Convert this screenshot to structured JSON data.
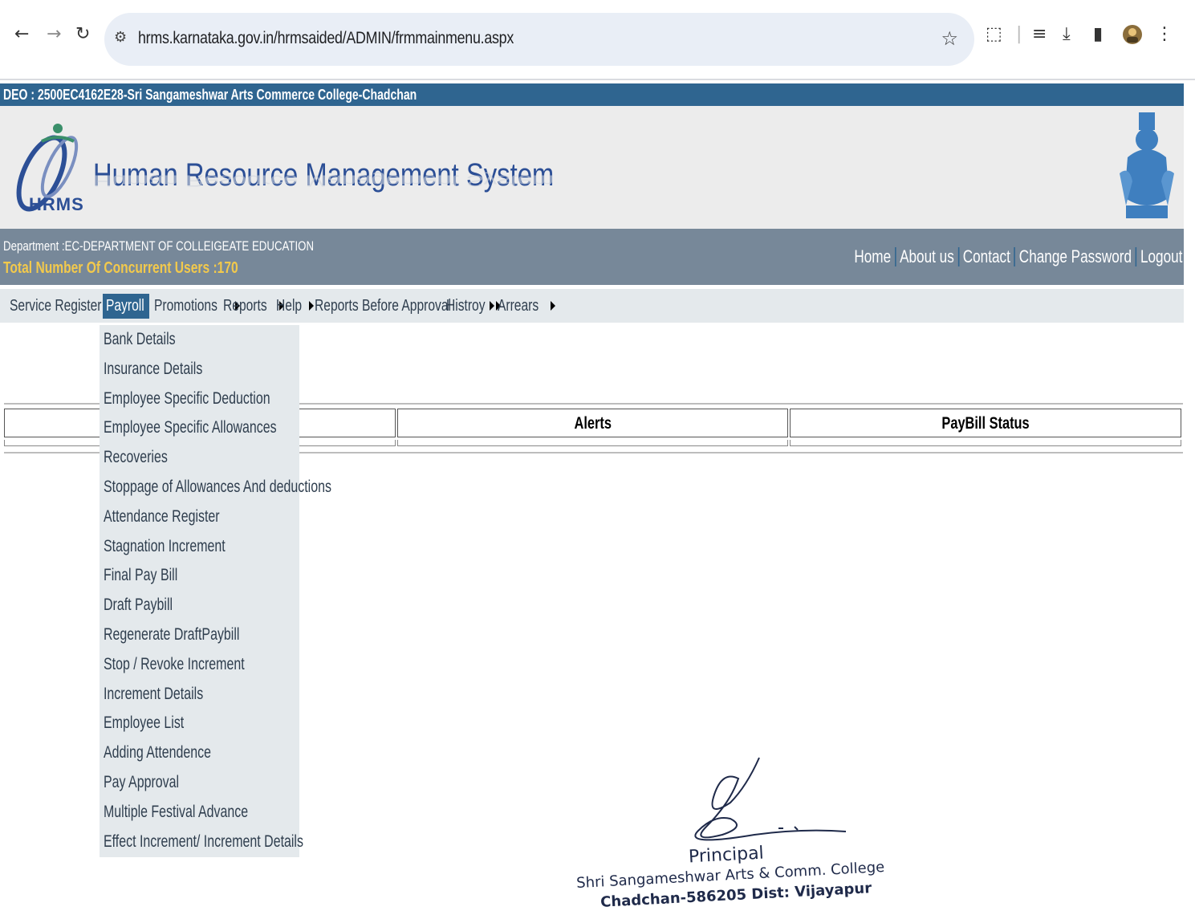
{
  "browser": {
    "url": "hrms.karnataka.gov.in/hrmsaided/ADMIN/frmmainmenu.aspx",
    "icons": [
      "back-icon",
      "forward-icon",
      "reload-icon",
      "site-info-icon",
      "star-icon",
      "extensions-icon",
      "reading-list-icon",
      "download-icon",
      "side-panel-icon",
      "profile-avatar",
      "more-menu-icon"
    ]
  },
  "header": {
    "deo_text": "DEO : 2500EC4162E28-Sri Sangameshwar Arts Commerce College-Chadchan",
    "logo_text": "HRMS",
    "system_title": "Human Resource Management System",
    "department": "Department :EC-DEPARTMENT OF COLLEIGEATE EDUCATION",
    "concurrent_users": "Total Number Of Concurrent Users :170",
    "links": [
      "Home",
      "About us",
      "Contact",
      "Change Password",
      "Logout"
    ]
  },
  "menu": [
    {
      "label": "Service Register",
      "active": false
    },
    {
      "label": "Payroll",
      "active": true
    },
    {
      "label": "Promotions",
      "active": false
    },
    {
      "label": "Reports",
      "active": false
    },
    {
      "label": "Help",
      "active": false
    },
    {
      "label": "Reports Before Approval",
      "active": false
    },
    {
      "label": "Histroy",
      "active": false
    },
    {
      "label": "Arrears",
      "active": false
    }
  ],
  "payroll_dropdown": [
    "Bank Details",
    "Insurance Details",
    "Employee Specific Deduction",
    "Employee Specific Allowances",
    "Recoveries",
    "Stoppage of Allowances And deductions",
    "Attendance Register",
    "Stagnation Increment",
    "Final Pay Bill",
    "Draft Paybill",
    "Regenerate DraftPaybill",
    "Stop / Revoke Increment",
    "Increment Details",
    "Employee List",
    "Adding Attendence",
    "Pay Approval",
    "Multiple Festival Advance",
    "Effect Increment/ Increment Details"
  ],
  "table": {
    "headers": [
      "",
      "Alerts",
      "PayBill Status"
    ]
  },
  "stamp": {
    "title": "Principal",
    "line1": "Shri Sangameshwar Arts & Comm. College",
    "line2": "Chadchan-586205 Dist: Vijayapur"
  },
  "colors": {
    "deo_bar": "#2f6590",
    "dept_bar": "#778899",
    "menu_bg": "#e4e9ec",
    "users_text": "#f2c94c",
    "title_blue": "#2c4f96"
  }
}
